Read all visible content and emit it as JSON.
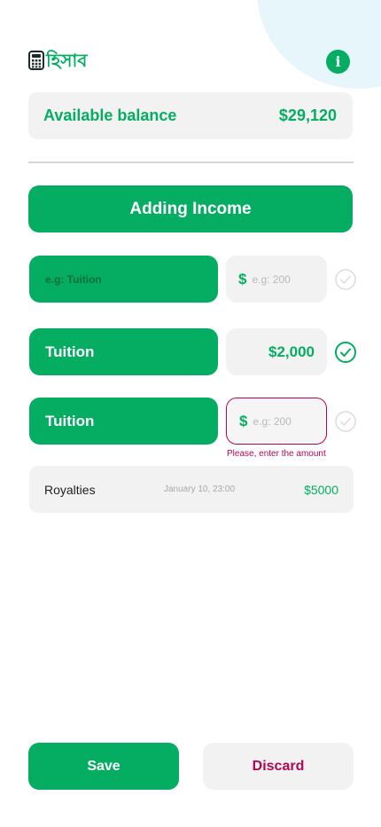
{
  "app": {
    "logo_text": "হিসাব"
  },
  "balance": {
    "label": "Available balance",
    "amount": "$29,120"
  },
  "section": {
    "title": "Adding Income"
  },
  "rows": [
    {
      "name_placeholder": "e.g: Tuition",
      "currency": "$",
      "amount_placeholder": "e.g: 200",
      "status": "inactive"
    },
    {
      "name": "Tuition",
      "amount": "$2,000",
      "status": "confirmed"
    },
    {
      "name": "Tuition",
      "currency": "$",
      "amount_placeholder": "e.g: 200",
      "error": "Please, enter the amount",
      "status": "inactive"
    }
  ],
  "entries": [
    {
      "name": "Royalties",
      "date": "January 10, 23:00",
      "amount": "$5000"
    }
  ],
  "actions": {
    "save_label": "Save",
    "discard_label": "Discard"
  },
  "colors": {
    "accent": "#04ad62",
    "error": "#b00753",
    "surface": "#f2f2f2",
    "blob": "#e6f6fb"
  }
}
